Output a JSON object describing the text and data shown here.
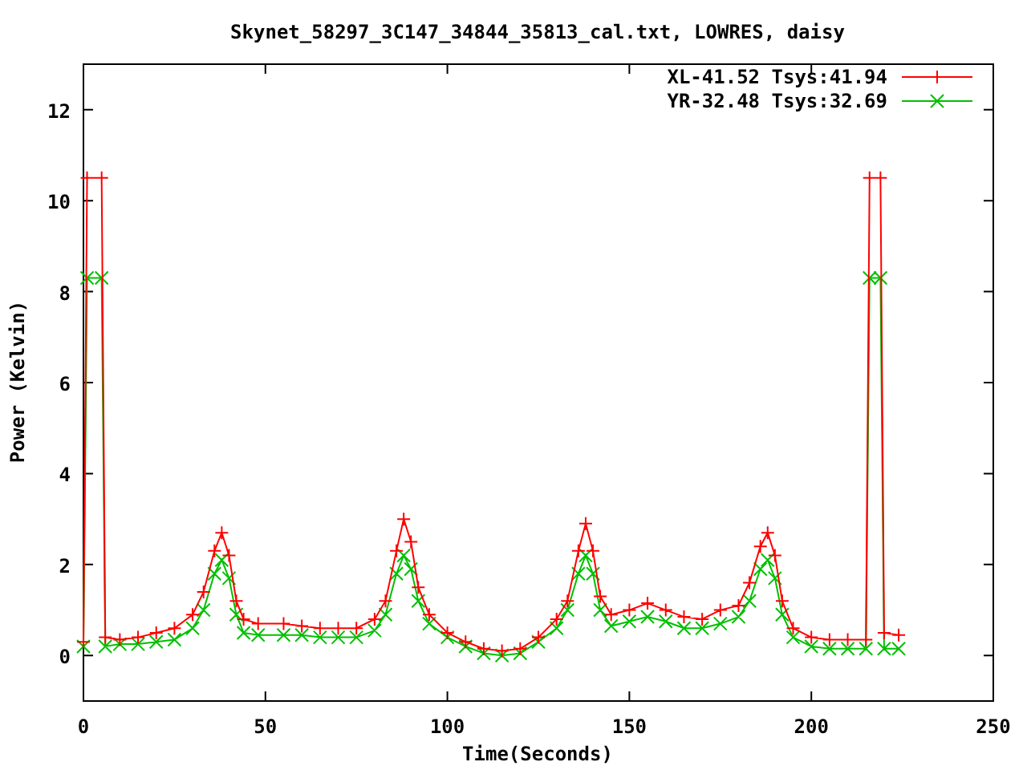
{
  "chart_data": {
    "type": "line",
    "title": "Skynet_58297_3C147_34844_35813_cal.txt, LOWRES, daisy",
    "xlabel": "Time(Seconds)",
    "ylabel": "Power (Kelvin)",
    "x": [
      0,
      1,
      5,
      6,
      10,
      15,
      20,
      25,
      30,
      33,
      36,
      38,
      40,
      42,
      44,
      48,
      55,
      60,
      65,
      70,
      75,
      80,
      83,
      86,
      88,
      90,
      92,
      95,
      100,
      105,
      110,
      115,
      120,
      125,
      130,
      133,
      136,
      138,
      140,
      142,
      145,
      150,
      155,
      160,
      165,
      170,
      175,
      180,
      183,
      186,
      188,
      190,
      192,
      195,
      200,
      205,
      210,
      215,
      216,
      219,
      220,
      224
    ],
    "series": [
      {
        "name": "XL-41.52 Tsys:41.94",
        "color": "#ff0000",
        "marker": "plus",
        "values": [
          0.3,
          10.5,
          10.5,
          0.4,
          0.35,
          0.4,
          0.5,
          0.6,
          0.9,
          1.4,
          2.3,
          2.7,
          2.2,
          1.2,
          0.8,
          0.7,
          0.7,
          0.65,
          0.6,
          0.6,
          0.6,
          0.8,
          1.2,
          2.3,
          3.0,
          2.5,
          1.5,
          0.9,
          0.5,
          0.3,
          0.15,
          0.1,
          0.15,
          0.4,
          0.8,
          1.2,
          2.3,
          2.9,
          2.3,
          1.3,
          0.9,
          1.0,
          1.15,
          1.0,
          0.85,
          0.8,
          1.0,
          1.1,
          1.6,
          2.4,
          2.7,
          2.2,
          1.2,
          0.6,
          0.4,
          0.35,
          0.35,
          0.35,
          10.5,
          10.5,
          0.5,
          0.45
        ]
      },
      {
        "name": "YR-32.48 Tsys:32.69",
        "color": "#00c000",
        "marker": "cross",
        "values": [
          0.2,
          8.3,
          8.3,
          0.2,
          0.25,
          0.25,
          0.3,
          0.35,
          0.6,
          1.0,
          1.8,
          2.1,
          1.7,
          0.9,
          0.5,
          0.45,
          0.45,
          0.45,
          0.4,
          0.4,
          0.4,
          0.55,
          0.9,
          1.8,
          2.2,
          1.9,
          1.2,
          0.7,
          0.4,
          0.2,
          0.05,
          0.0,
          0.05,
          0.3,
          0.6,
          1.0,
          1.8,
          2.2,
          1.8,
          1.0,
          0.65,
          0.75,
          0.85,
          0.75,
          0.6,
          0.6,
          0.7,
          0.85,
          1.2,
          1.9,
          2.1,
          1.7,
          0.9,
          0.4,
          0.2,
          0.15,
          0.15,
          0.15,
          8.3,
          8.3,
          0.15,
          0.15
        ]
      }
    ],
    "legend": true,
    "xlim": [
      0,
      250
    ],
    "ylim": [
      -1,
      13
    ],
    "xticks": [
      0,
      50,
      100,
      150,
      200,
      250
    ],
    "yticks": [
      0,
      2,
      4,
      6,
      8,
      10,
      12
    ]
  }
}
